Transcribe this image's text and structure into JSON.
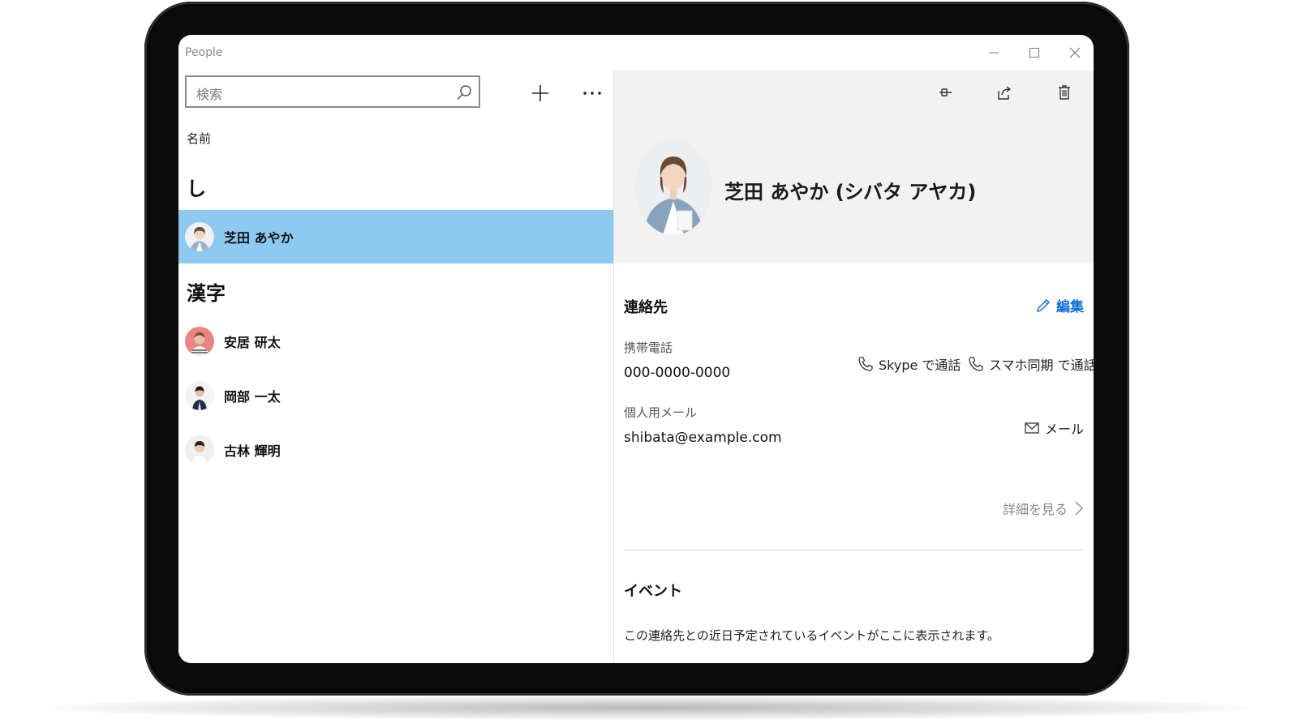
{
  "window": {
    "title": "People"
  },
  "left_pane": {
    "search": {
      "placeholder": "検索"
    },
    "sort_label": "名前",
    "groups": [
      {
        "header": "し",
        "contacts": [
          {
            "name": "芝田 あやか",
            "selected": true
          }
        ]
      },
      {
        "header": "漢字",
        "contacts": [
          {
            "name": "安居 研太",
            "selected": false
          },
          {
            "name": "岡部 一太",
            "selected": false
          },
          {
            "name": "古林 輝明",
            "selected": false
          }
        ]
      }
    ]
  },
  "detail": {
    "name": "芝田 あやか (シバタ アヤカ)",
    "contact_section": {
      "title": "連絡先",
      "edit_label": "編集",
      "phone_label": "携帯電話",
      "phone_value": "000-0000-0000",
      "skype_call_label": "Skype で通話",
      "phone_link_call_label": "スマホ同期 で通話",
      "email_label": "個人用メール",
      "email_value": "shibata@example.com",
      "mail_action_label": "メール",
      "more_details_label": "詳細を見る"
    },
    "events_section": {
      "title": "イベント",
      "description": "この連絡先との近日予定されているイベントがここに表示されます。"
    }
  },
  "colors": {
    "selection": "#8ec9f2",
    "accent_link": "#0a6fd6",
    "hero_background": "#f2f2f2"
  }
}
